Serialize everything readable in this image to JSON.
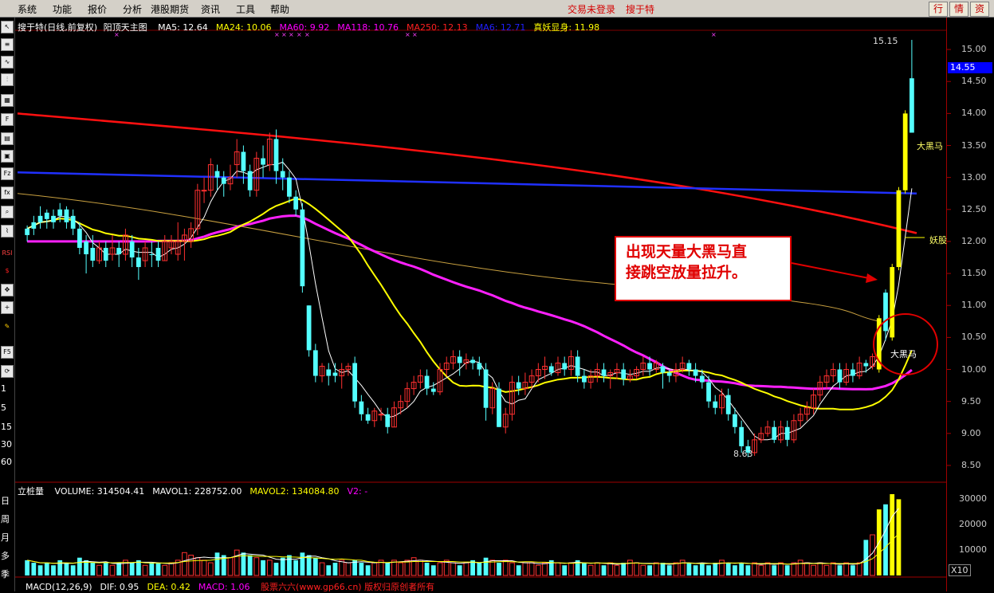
{
  "menu": {
    "items": [
      "系统",
      "功能",
      "报价",
      "分析",
      "港股期货",
      "资讯",
      "工具",
      "帮助"
    ],
    "login_status": "交易未登录",
    "stock_name": "搜于特",
    "buttons": [
      "行",
      "情",
      "资"
    ]
  },
  "chart_header": {
    "title": "搜于特(日线,前复权)",
    "indicator_name": "阳顶天主图",
    "ma": [
      {
        "label": "MA5: 12.64",
        "color": "#ffffff"
      },
      {
        "label": "MA24: 10.06",
        "color": "#ffff00"
      },
      {
        "label": "MA60: 9.92",
        "color": "#ff00ff"
      },
      {
        "label": "MA118: 10.76",
        "color": "#ff00ff"
      },
      {
        "label": "MA250: 12.13",
        "color": "#ff2020"
      },
      {
        "label": "MA6: 12.71",
        "color": "#2020ff"
      },
      {
        "label": "真妖显身: 11.98",
        "color": "#ffff00"
      }
    ]
  },
  "price_axis": {
    "ticks": [
      "15.00",
      "14.50",
      "14.00",
      "13.50",
      "13.00",
      "12.50",
      "12.00",
      "11.50",
      "11.00",
      "10.50",
      "10.00",
      "9.50",
      "9.00",
      "8.50"
    ],
    "current_price": "14.55"
  },
  "chart_labels": {
    "high_label": "15.15",
    "low_label": "8.63",
    "dahei_ma_top": "大黑马",
    "yaogu": "妖股",
    "dahei_ma_circle": "大黑马"
  },
  "annotation": {
    "line1": "出现天量大黑马直",
    "line2": "接跳空放量拉升。"
  },
  "volume_header": {
    "name": "立桩量",
    "items": [
      {
        "label": "VOLUME: 314504.41",
        "color": "#ffffff"
      },
      {
        "label": "MAVOL1: 228752.00",
        "color": "#ffffff"
      },
      {
        "label": "MAVOL2: 134084.80",
        "color": "#ffff00"
      },
      {
        "label": "V2: -",
        "color": "#ff00ff"
      }
    ]
  },
  "volume_axis": {
    "ticks": [
      "30000",
      "20000",
      "10000"
    ],
    "multiplier": "X10"
  },
  "macd_header": {
    "items": [
      {
        "label": "MACD(12,26,9)",
        "color": "#ffffff"
      },
      {
        "label": "DIF: 0.95",
        "color": "#ffffff"
      },
      {
        "label": "DEA: 0.42",
        "color": "#ffff00"
      },
      {
        "label": "MACD: 1.06",
        "color": "#ff00ff"
      }
    ],
    "watermark": "股票六六(www.gp66.cn) 版权归原创者所有"
  },
  "left_toolbar": {
    "periods": [
      "1",
      "5",
      "15",
      "30",
      "60",
      "日",
      "周",
      "月",
      "多",
      "季"
    ]
  },
  "chart_data": {
    "type": "candlestick",
    "y_range": [
      8.3,
      15.3
    ],
    "candles": [
      [
        12.1,
        12.2,
        12.0,
        12.25,
        "c"
      ],
      [
        12.2,
        12.3,
        12.1,
        12.4,
        "c"
      ],
      [
        12.3,
        12.4,
        12.2,
        12.55,
        "c"
      ],
      [
        12.45,
        12.35,
        12.2,
        12.5,
        "c"
      ],
      [
        12.3,
        12.4,
        12.2,
        12.5,
        "c"
      ],
      [
        12.4,
        12.5,
        12.3,
        12.6,
        "c"
      ],
      [
        12.5,
        12.3,
        12.2,
        12.55,
        "c"
      ],
      [
        12.4,
        12.2,
        12.1,
        12.5,
        "c"
      ],
      [
        12.2,
        11.9,
        11.8,
        12.3,
        "c"
      ],
      [
        12.0,
        11.8,
        11.5,
        12.1,
        "c"
      ],
      [
        11.9,
        11.7,
        11.6,
        12.1,
        "c"
      ],
      [
        11.7,
        11.9,
        11.65,
        12.0,
        "r"
      ],
      [
        11.9,
        11.7,
        11.6,
        12.0,
        "c"
      ],
      [
        11.8,
        11.9,
        11.7,
        12.1,
        "r"
      ],
      [
        11.9,
        11.8,
        11.6,
        12.0,
        "c"
      ],
      [
        11.8,
        12.1,
        11.7,
        12.2,
        "r"
      ],
      [
        12.0,
        11.75,
        11.6,
        12.1,
        "c"
      ],
      [
        11.75,
        11.6,
        11.4,
        11.9,
        "c"
      ],
      [
        11.7,
        11.9,
        11.6,
        12.0,
        "r"
      ],
      [
        11.8,
        11.8,
        11.6,
        12.0,
        "c"
      ],
      [
        11.9,
        11.7,
        11.6,
        12.0,
        "c"
      ],
      [
        11.7,
        12.0,
        11.7,
        12.1,
        "r"
      ],
      [
        11.9,
        12.0,
        11.8,
        12.1,
        "r"
      ],
      [
        11.8,
        12.0,
        11.7,
        12.3,
        "r"
      ],
      [
        12.0,
        12.1,
        11.7,
        12.2,
        "r"
      ],
      [
        12.0,
        12.2,
        11.9,
        12.3,
        "r"
      ],
      [
        12.2,
        12.8,
        12.1,
        12.9,
        "r"
      ],
      [
        12.8,
        12.8,
        12.6,
        13.0,
        "r"
      ],
      [
        12.8,
        13.2,
        12.7,
        13.3,
        "r"
      ],
      [
        13.1,
        13.0,
        12.8,
        13.2,
        "c"
      ],
      [
        13.0,
        12.9,
        12.7,
        13.1,
        "c"
      ],
      [
        12.9,
        13.0,
        12.8,
        13.2,
        "r"
      ],
      [
        13.2,
        13.4,
        13.0,
        13.6,
        "r"
      ],
      [
        13.4,
        13.1,
        12.9,
        13.5,
        "c"
      ],
      [
        13.1,
        12.8,
        12.7,
        13.2,
        "c"
      ],
      [
        12.8,
        13.3,
        12.7,
        13.4,
        "r"
      ],
      [
        13.3,
        13.2,
        13.0,
        13.5,
        "c"
      ],
      [
        13.2,
        13.6,
        13.1,
        13.7,
        "r"
      ],
      [
        13.6,
        13.1,
        12.9,
        13.75,
        "c"
      ],
      [
        13.1,
        13.0,
        12.8,
        13.3,
        "c"
      ],
      [
        13.0,
        12.7,
        12.6,
        13.1,
        "c"
      ],
      [
        12.7,
        12.5,
        12.4,
        12.8,
        "c"
      ],
      [
        12.5,
        11.3,
        11.2,
        12.6,
        "c"
      ],
      [
        11.0,
        10.3,
        10.2,
        11.0,
        "c"
      ],
      [
        10.3,
        9.9,
        9.8,
        10.4,
        "c"
      ],
      [
        9.9,
        10.05,
        9.8,
        10.1,
        "r"
      ],
      [
        10.0,
        9.9,
        9.75,
        10.1,
        "c"
      ],
      [
        9.95,
        9.9,
        9.8,
        10.1,
        "c"
      ],
      [
        9.9,
        10.0,
        9.7,
        10.1,
        "r"
      ],
      [
        10.0,
        10.05,
        9.9,
        10.1,
        "r"
      ],
      [
        10.1,
        9.5,
        9.4,
        10.2,
        "c"
      ],
      [
        9.5,
        9.3,
        9.2,
        9.6,
        "c"
      ],
      [
        9.3,
        9.2,
        9.15,
        9.4,
        "c"
      ],
      [
        9.2,
        9.35,
        9.1,
        9.4,
        "r"
      ],
      [
        9.3,
        9.3,
        9.2,
        9.4,
        "r"
      ],
      [
        9.3,
        9.1,
        9.0,
        9.4,
        "c"
      ],
      [
        9.1,
        9.4,
        9.1,
        9.5,
        "r"
      ],
      [
        9.4,
        9.5,
        9.3,
        9.6,
        "r"
      ],
      [
        9.5,
        9.7,
        9.4,
        9.8,
        "r"
      ],
      [
        9.7,
        9.8,
        9.6,
        9.9,
        "r"
      ],
      [
        9.8,
        9.9,
        9.7,
        10.0,
        "r"
      ],
      [
        9.9,
        9.7,
        9.6,
        10.0,
        "c"
      ],
      [
        9.7,
        9.65,
        9.6,
        9.8,
        "c"
      ],
      [
        9.65,
        10.0,
        9.6,
        10.1,
        "r"
      ],
      [
        10.0,
        10.1,
        9.9,
        10.2,
        "r"
      ],
      [
        10.1,
        10.2,
        10.0,
        10.3,
        "r"
      ],
      [
        10.2,
        10.1,
        9.9,
        10.3,
        "c"
      ],
      [
        10.1,
        10.15,
        10.0,
        10.25,
        "r"
      ],
      [
        10.15,
        10.1,
        10.0,
        10.2,
        "c"
      ],
      [
        10.1,
        10.0,
        9.9,
        10.2,
        "c"
      ],
      [
        10.0,
        9.4,
        9.2,
        10.1,
        "c"
      ],
      [
        9.4,
        9.7,
        9.3,
        9.8,
        "r"
      ],
      [
        9.7,
        9.1,
        9.1,
        9.8,
        "c"
      ],
      [
        9.1,
        9.3,
        9.0,
        9.4,
        "r"
      ],
      [
        9.3,
        9.8,
        9.2,
        9.9,
        "r"
      ],
      [
        9.8,
        9.7,
        9.6,
        9.9,
        "c"
      ],
      [
        9.7,
        9.8,
        9.6,
        9.95,
        "r"
      ],
      [
        9.8,
        9.9,
        9.7,
        10.0,
        "r"
      ],
      [
        9.9,
        10.0,
        9.8,
        10.1,
        "r"
      ],
      [
        10.0,
        10.05,
        9.85,
        10.2,
        "r"
      ],
      [
        10.05,
        9.95,
        9.9,
        10.1,
        "c"
      ],
      [
        9.95,
        10.1,
        9.9,
        10.2,
        "r"
      ],
      [
        10.1,
        10.0,
        9.9,
        10.2,
        "c"
      ],
      [
        10.0,
        10.2,
        9.9,
        10.3,
        "r"
      ],
      [
        10.2,
        9.9,
        9.8,
        10.3,
        "c"
      ],
      [
        9.9,
        9.8,
        9.7,
        10.0,
        "c"
      ],
      [
        9.8,
        9.9,
        9.7,
        10.0,
        "r"
      ],
      [
        9.9,
        10.0,
        9.8,
        10.1,
        "r"
      ],
      [
        10.0,
        9.9,
        9.8,
        10.1,
        "c"
      ],
      [
        9.9,
        9.95,
        9.7,
        10.0,
        "r"
      ],
      [
        9.95,
        10.0,
        9.85,
        10.1,
        "r"
      ],
      [
        10.0,
        9.85,
        9.75,
        10.1,
        "c"
      ],
      [
        9.85,
        9.9,
        9.8,
        10.0,
        "r"
      ],
      [
        9.9,
        10.0,
        9.85,
        10.05,
        "r"
      ],
      [
        10.0,
        10.1,
        9.9,
        10.2,
        "r"
      ],
      [
        10.1,
        10.0,
        9.9,
        10.2,
        "c"
      ],
      [
        10.0,
        10.1,
        9.95,
        10.15,
        "r"
      ],
      [
        10.05,
        9.95,
        9.7,
        10.1,
        "c"
      ],
      [
        9.95,
        9.9,
        9.8,
        10.0,
        "c"
      ],
      [
        9.9,
        10.0,
        9.8,
        10.1,
        "r"
      ],
      [
        10.0,
        10.1,
        9.95,
        10.2,
        "r"
      ],
      [
        10.1,
        10.0,
        9.9,
        10.15,
        "c"
      ],
      [
        10.0,
        9.9,
        9.8,
        10.1,
        "c"
      ],
      [
        9.9,
        9.8,
        9.7,
        10.0,
        "c"
      ],
      [
        9.8,
        9.5,
        9.4,
        9.9,
        "c"
      ],
      [
        9.5,
        9.4,
        9.3,
        9.6,
        "c"
      ],
      [
        9.4,
        9.6,
        9.3,
        9.7,
        "r"
      ],
      [
        9.6,
        9.3,
        9.2,
        9.7,
        "c"
      ],
      [
        9.3,
        9.1,
        9.0,
        9.4,
        "c"
      ],
      [
        9.1,
        8.8,
        8.7,
        9.2,
        "c"
      ],
      [
        8.8,
        8.7,
        8.63,
        8.9,
        "c"
      ],
      [
        8.7,
        8.9,
        8.65,
        9.0,
        "r"
      ],
      [
        8.9,
        9.0,
        8.85,
        9.1,
        "r"
      ],
      [
        9.0,
        9.1,
        8.95,
        9.2,
        "r"
      ],
      [
        9.1,
        8.9,
        8.85,
        9.2,
        "c"
      ],
      [
        8.9,
        9.1,
        8.85,
        9.2,
        "r"
      ],
      [
        9.1,
        8.9,
        8.8,
        9.2,
        "c"
      ],
      [
        8.9,
        9.2,
        8.85,
        9.3,
        "r"
      ],
      [
        9.2,
        9.3,
        9.1,
        9.4,
        "r"
      ],
      [
        9.3,
        9.4,
        9.2,
        9.5,
        "r"
      ],
      [
        9.4,
        9.6,
        9.3,
        9.7,
        "r"
      ],
      [
        9.6,
        9.8,
        9.5,
        9.9,
        "r"
      ],
      [
        9.8,
        9.9,
        9.7,
        10.0,
        "r"
      ],
      [
        9.9,
        10.0,
        9.8,
        10.1,
        "r"
      ],
      [
        10.0,
        9.8,
        9.7,
        10.1,
        "c"
      ],
      [
        9.8,
        10.0,
        9.75,
        10.1,
        "r"
      ],
      [
        10.0,
        9.9,
        9.8,
        10.1,
        "c"
      ],
      [
        9.9,
        10.1,
        9.85,
        10.2,
        "r"
      ],
      [
        10.1,
        10.05,
        9.95,
        10.15,
        "c"
      ],
      [
        10.05,
        10.2,
        10.0,
        10.25,
        "r"
      ],
      [
        10.0,
        10.8,
        9.95,
        10.85,
        "y"
      ],
      [
        10.6,
        11.2,
        10.45,
        11.25,
        "c"
      ],
      [
        10.5,
        11.6,
        10.45,
        11.65,
        "y"
      ],
      [
        11.6,
        12.8,
        11.55,
        12.85,
        "y"
      ],
      [
        12.8,
        14.0,
        12.75,
        14.05,
        "y"
      ],
      [
        13.7,
        14.55,
        13.7,
        15.15,
        "c"
      ]
    ],
    "volume": [
      6,
      5,
      4,
      5,
      4,
      6,
      5,
      4,
      7,
      6,
      5,
      4,
      5,
      4,
      5,
      6,
      5,
      6,
      4,
      5,
      5,
      4,
      5,
      6,
      9,
      8,
      7,
      6,
      5,
      9,
      8,
      7,
      10,
      9,
      8,
      7,
      6,
      6,
      5,
      7,
      8,
      6,
      9,
      8,
      7,
      5,
      4,
      5,
      6,
      5,
      6,
      5,
      4,
      5,
      6,
      5,
      6,
      5,
      6,
      7,
      6,
      5,
      4,
      5,
      6,
      5,
      4,
      5,
      6,
      5,
      7,
      6,
      5,
      6,
      5,
      4,
      5,
      5,
      4,
      5,
      6,
      5,
      4,
      5,
      6,
      5,
      4,
      5,
      4,
      5,
      4,
      5,
      6,
      5,
      4,
      4,
      5,
      5,
      4,
      5,
      6,
      5,
      4,
      5,
      4,
      5,
      6,
      5,
      4,
      5,
      4,
      5,
      4,
      5,
      4,
      5,
      4,
      5,
      6,
      5,
      4,
      5,
      4,
      5,
      4,
      5,
      4,
      5,
      14,
      16,
      26,
      28,
      32,
      30
    ],
    "volume_y_range": [
      0,
      32000
    ]
  }
}
